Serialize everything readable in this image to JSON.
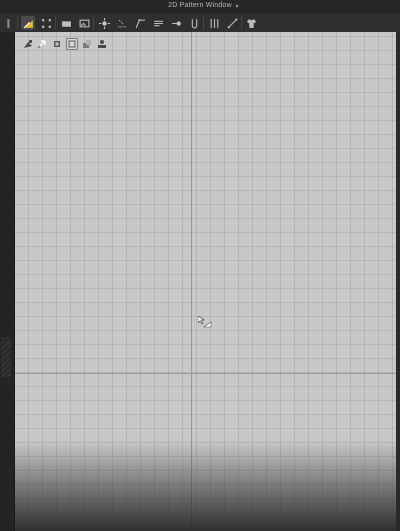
{
  "window": {
    "title": "2D Pattern Window"
  },
  "toolbar": {
    "tools": [
      {
        "icon": "panel-toggle-icon"
      },
      {
        "icon": "select-pen-icon",
        "active": true
      },
      {
        "icon": "transform-box-icon"
      },
      {
        "icon": "rectangle-icon"
      },
      {
        "icon": "image-icon"
      },
      {
        "icon": "sun-icon"
      },
      {
        "icon": "dotted-lines-icon"
      },
      {
        "icon": "slope-icon"
      },
      {
        "icon": "stack-lines-icon"
      },
      {
        "icon": "pin-arrow-icon"
      },
      {
        "icon": "sewing-u-icon"
      },
      {
        "icon": "pleat-lines-icon"
      },
      {
        "icon": "measure-line-icon"
      },
      {
        "icon": "tshirt-icon"
      }
    ]
  },
  "viewport_tools": [
    {
      "icon": "pointer-hand-icon"
    },
    {
      "icon": "move-arrow-icon"
    },
    {
      "icon": "layers-icon"
    },
    {
      "icon": "pattern-box-icon",
      "boxed": true
    },
    {
      "icon": "fabric-icon"
    },
    {
      "icon": "avatar-icon"
    }
  ],
  "colors": {
    "background": "#2b2b2b",
    "canvas": "#c8c8c8",
    "accent": "#e5b63a"
  }
}
